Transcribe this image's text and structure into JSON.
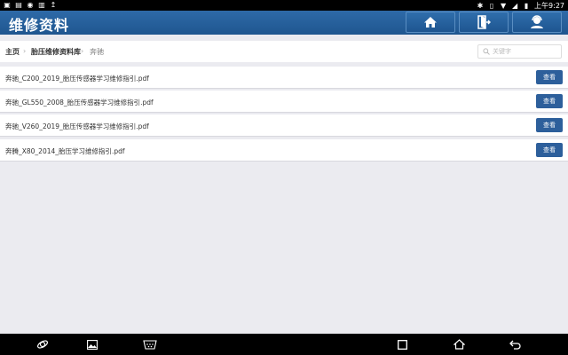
{
  "status_bar": {
    "time": "上午9:27"
  },
  "app": {
    "title": "维修资料"
  },
  "header_buttons": {
    "home": "home-icon",
    "exit": "exit-icon",
    "support": "support-icon"
  },
  "breadcrumb": {
    "items": [
      "主页",
      "胎压维修资料库",
      "奔驰"
    ]
  },
  "search": {
    "placeholder": "关键字",
    "value": ""
  },
  "files": [
    {
      "name": "奔驰_C200_2019_胎压传感器学习维修指引.pdf",
      "action": "查看"
    },
    {
      "name": "奔驰_GL550_2008_胎压传感器学习维修指引.pdf",
      "action": "查看"
    },
    {
      "name": "奔驰_V260_2019_胎压传感器学习维修指引.pdf",
      "action": "查看"
    },
    {
      "name": "奔腾_X80_2014_胎压学习维修指引.pdf",
      "action": "查看"
    }
  ],
  "colors": {
    "appbar": "#2563a0",
    "button": "#2d5f9b",
    "background": "#ebebf0",
    "statusbar": "#000000"
  }
}
